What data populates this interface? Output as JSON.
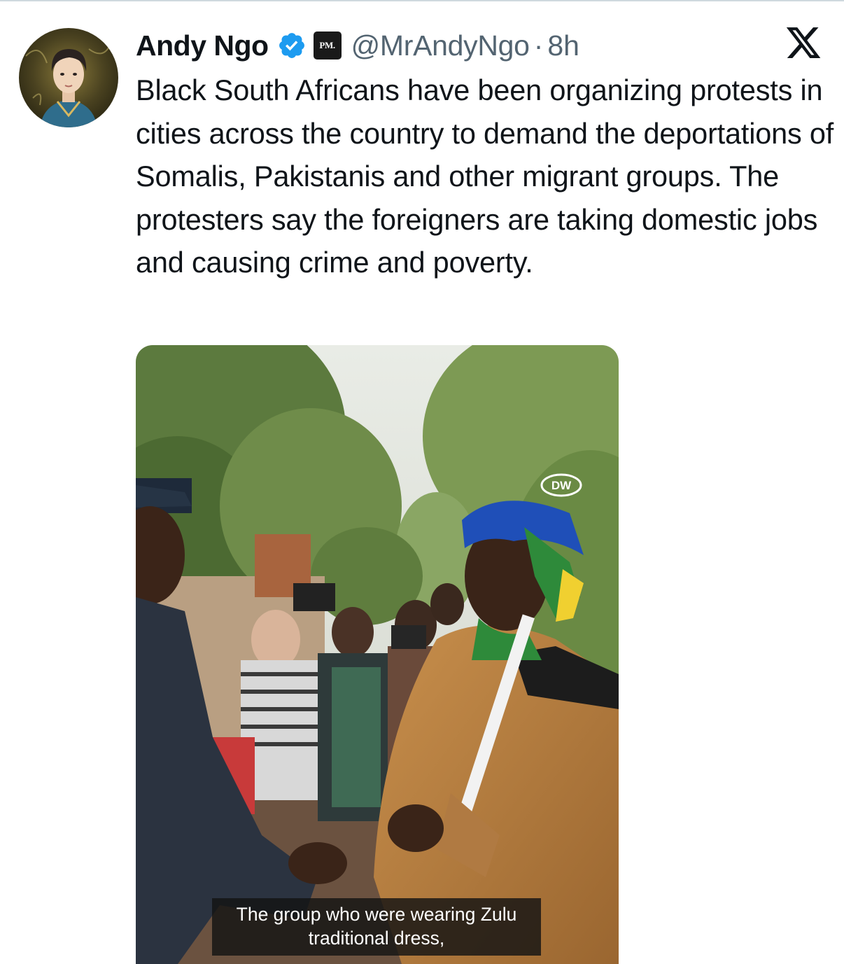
{
  "author": {
    "name": "Andy Ngo",
    "handle": "@MrAndyNgo",
    "separator": "·",
    "time": "8h",
    "affiliate_badge_text": "PM.",
    "verified_color": "#1d9bf0"
  },
  "platform_logo": "x-logo-icon",
  "tweet": {
    "text": "Black South Africans have been organizing protests in cities across the country to demand the deportations of Somalis, Pakistanis and other migrant groups. The protesters say the foreigners are taking domestic jobs and causing crime and poverty."
  },
  "media": {
    "watermark": "DW",
    "caption_line1": "The group who were wearing Zulu",
    "caption_line2": "traditional dress,"
  }
}
